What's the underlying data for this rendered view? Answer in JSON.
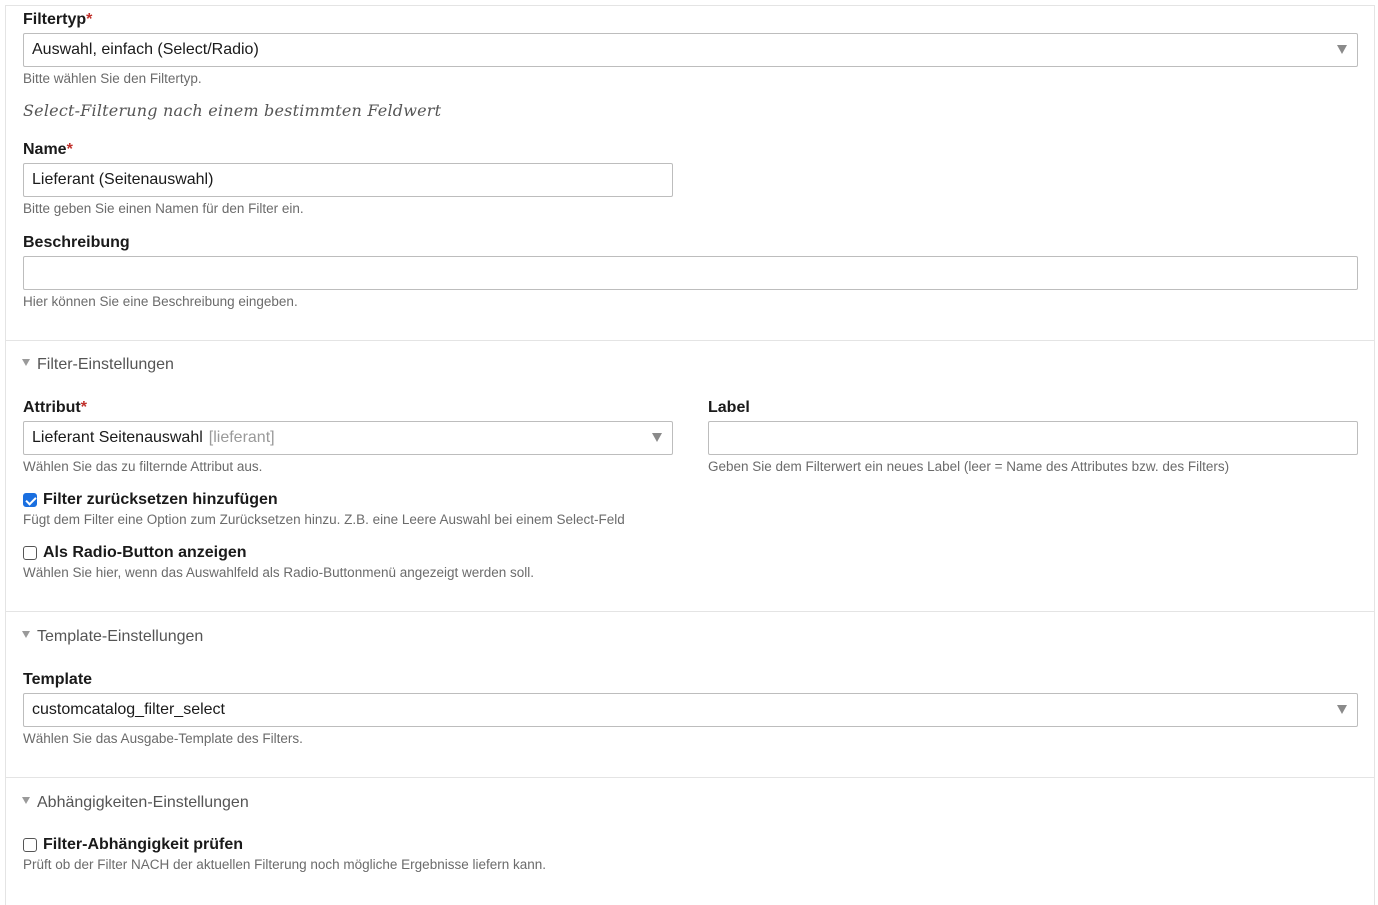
{
  "filtertyp": {
    "label": "Filtertyp",
    "required_mark": "*",
    "value": "Auswahl, einfach (Select/Radio)",
    "help": "Bitte wählen Sie den Filtertyp.",
    "description": "Select-Filterung nach einem bestimmten Feldwert"
  },
  "name": {
    "label": "Name",
    "required_mark": "*",
    "value": "Lieferant (Seitenauswahl)",
    "help": "Bitte geben Sie einen Namen für den Filter ein."
  },
  "beschreibung": {
    "label": "Beschreibung",
    "value": "",
    "help": "Hier können Sie eine Beschreibung eingeben."
  },
  "filter_settings": {
    "title": "Filter-Einstellungen",
    "attribut": {
      "label": "Attribut",
      "required_mark": "*",
      "value": "Lieferant Seitenauswahl",
      "value_key": "[lieferant]",
      "help": "Wählen Sie das zu filternde Attribut aus."
    },
    "label_field": {
      "label": "Label",
      "value": "",
      "help": "Geben Sie dem Filterwert ein neues Label (leer = Name des Attributes bzw. des Filters)"
    },
    "reset": {
      "label": "Filter zurücksetzen hinzufügen",
      "checked": true,
      "help": "Fügt dem Filter eine Option zum Zurücksetzen hinzu. Z.B. eine Leere Auswahl bei einem Select-Feld"
    },
    "radio": {
      "label": "Als Radio-Button anzeigen",
      "checked": false,
      "help": "Wählen Sie hier, wenn das Auswahlfeld als Radio-Buttonmenü angezeigt werden soll."
    }
  },
  "template_settings": {
    "title": "Template-Einstellungen",
    "template": {
      "label": "Template",
      "value": "customcatalog_filter_select",
      "help": "Wählen Sie das Ausgabe-Template des Filters."
    }
  },
  "dependency_settings": {
    "title": "Abhängigkeiten-Einstellungen",
    "check": {
      "label": "Filter-Abhängigkeit prüfen",
      "checked": false,
      "help": "Prüft ob der Filter NACH der aktuellen Filterung noch mögliche Ergebnisse liefern kann."
    }
  },
  "colors": {
    "required": "#c0302b",
    "checkbox_checked": "#1a6fe0",
    "help_text": "#6b6b6b",
    "border": "#bdbdbd"
  }
}
